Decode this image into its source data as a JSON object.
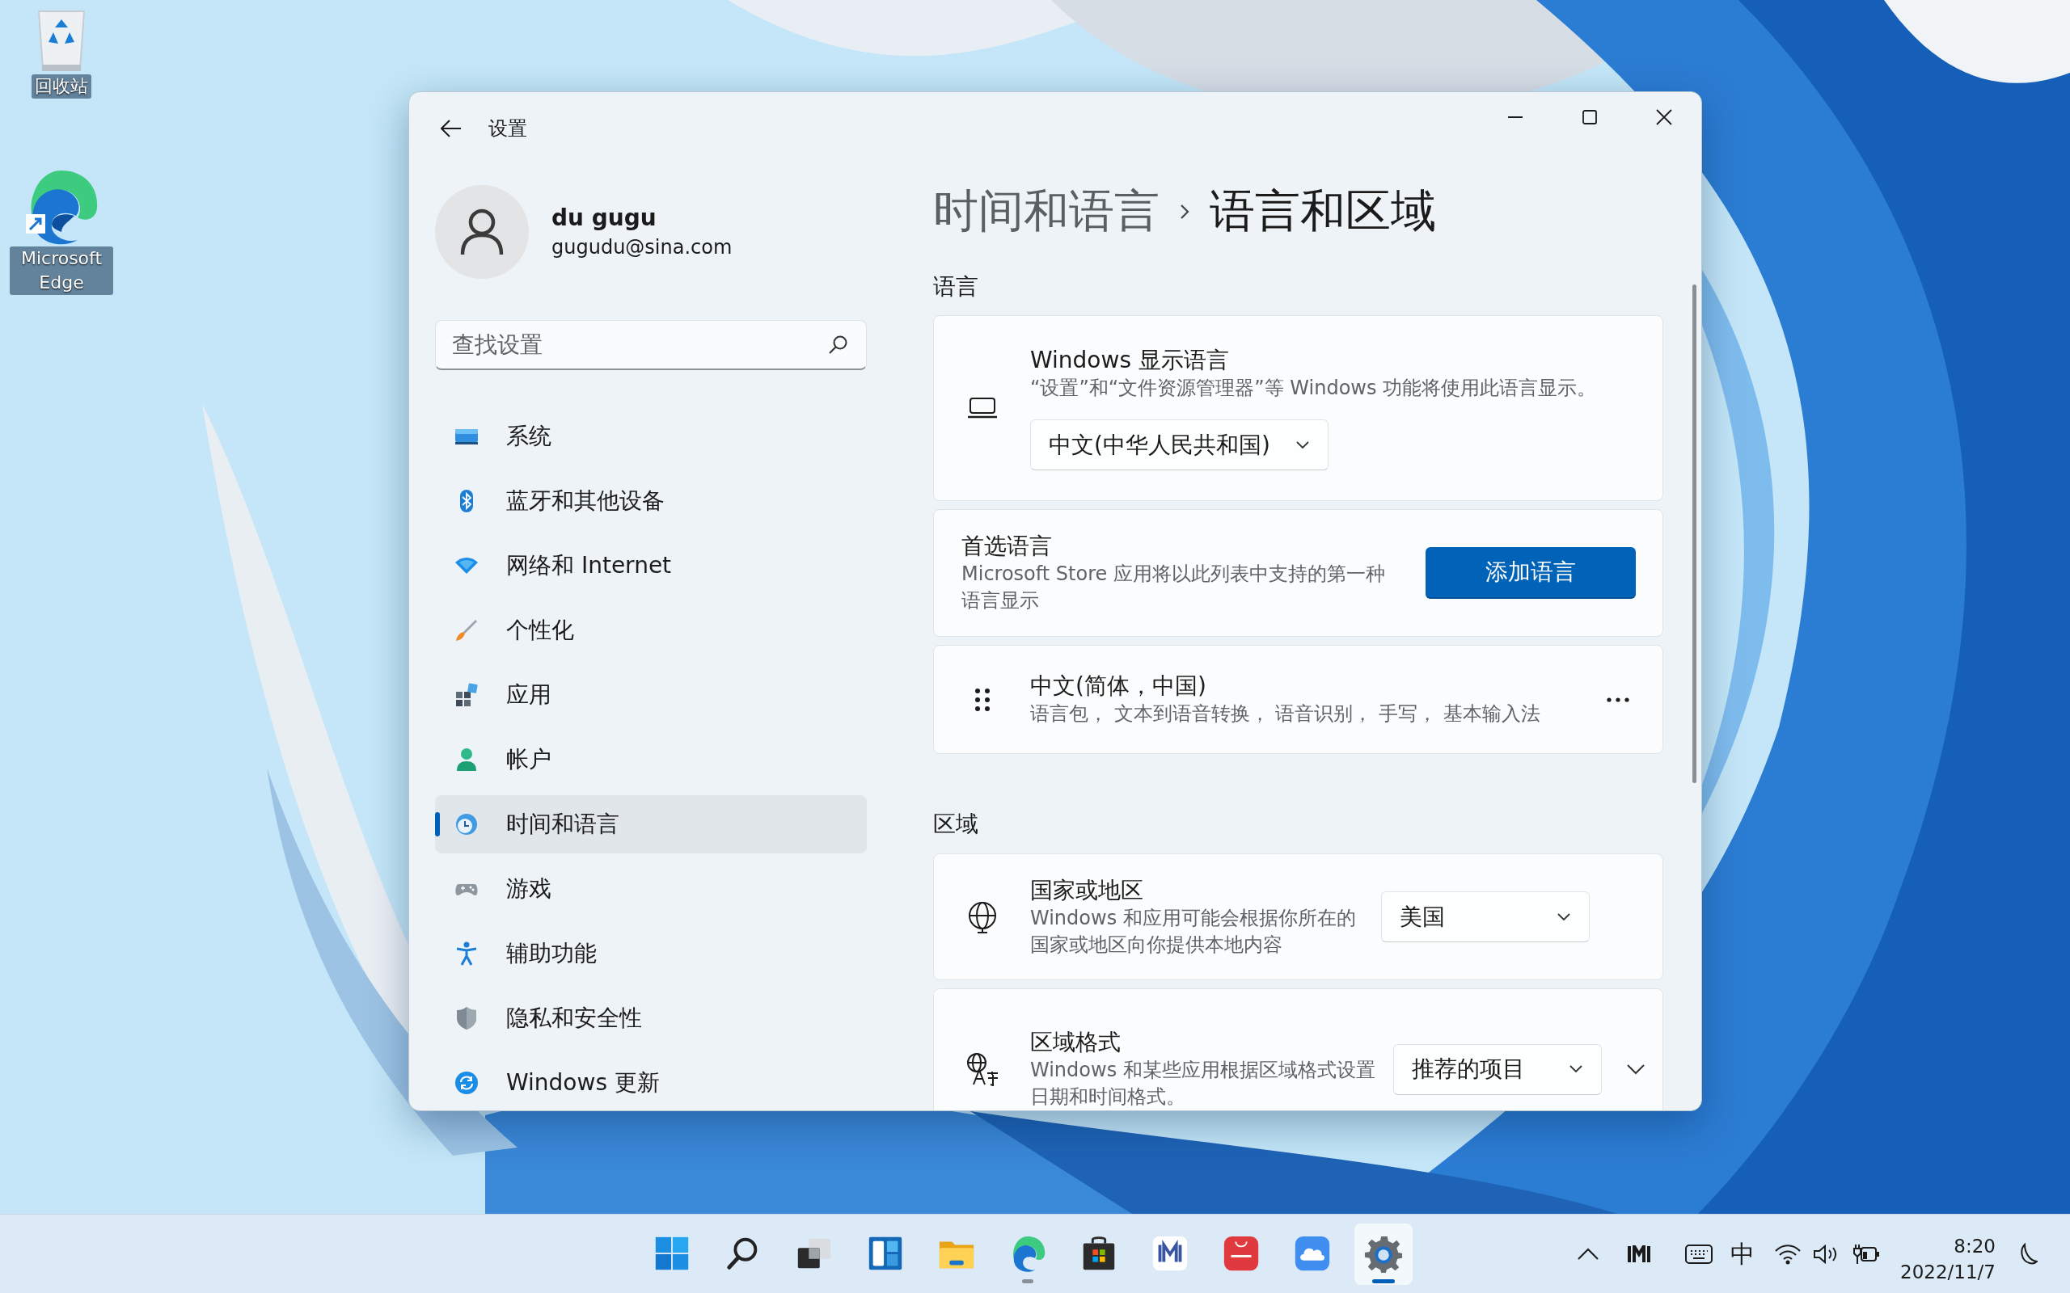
{
  "desktop": {
    "icons": [
      {
        "kind": "recycle-bin",
        "label": "回收站"
      },
      {
        "kind": "edge",
        "label": "Microsoft Edge"
      }
    ]
  },
  "window": {
    "title": "设置"
  },
  "account": {
    "name": "du gugu",
    "email": "gugudu@sina.com"
  },
  "search": {
    "placeholder": "查找设置"
  },
  "nav": [
    {
      "kind": "system",
      "label": "系统",
      "selected": false
    },
    {
      "kind": "bluetooth",
      "label": "蓝牙和其他设备",
      "selected": false
    },
    {
      "kind": "network",
      "label": "网络和 Internet",
      "selected": false
    },
    {
      "kind": "personalize",
      "label": "个性化",
      "selected": false
    },
    {
      "kind": "apps",
      "label": "应用",
      "selected": false
    },
    {
      "kind": "accounts",
      "label": "帐户",
      "selected": false
    },
    {
      "kind": "time",
      "label": "时间和语言",
      "selected": true
    },
    {
      "kind": "gaming",
      "label": "游戏",
      "selected": false
    },
    {
      "kind": "accessibility",
      "label": "辅助功能",
      "selected": false
    },
    {
      "kind": "privacy",
      "label": "隐私和安全性",
      "selected": false
    },
    {
      "kind": "update",
      "label": "Windows 更新",
      "selected": false
    }
  ],
  "breadcrumb": {
    "parent": "时间和语言",
    "current": "语言和区域"
  },
  "sections": [
    {
      "heading": "语言",
      "cards": [
        {
          "kind": "stacked",
          "title": "Windows 显示语言",
          "description": "“设置”和“文件资源管理器”等 Windows 功能将使用此语言显示。",
          "dropdown": "中文(中华人民共和国)"
        },
        {
          "kind": "row",
          "title": "首选语言",
          "description": "Microsoft Store 应用将以此列表中支持的第一种语言显示",
          "button": "添加语言"
        },
        {
          "kind": "row",
          "title": "中文(简体，中国)",
          "description": "语言包， 文本到语音转换， 语音识别， 手写， 基本输入法",
          "menu": true
        }
      ]
    },
    {
      "heading": "区域",
      "cards": [
        {
          "kind": "row",
          "title": "国家或地区",
          "description": "Windows 和应用可能会根据你所在的国家或地区向你提供本地内容",
          "dropdown": "美国"
        },
        {
          "kind": "row",
          "title": "区域格式",
          "description": "Windows 和某些应用根据区域格式设置日期和时间格式。",
          "dropdown": "推荐的项目",
          "expanded": false
        }
      ]
    }
  ],
  "taskbar": {
    "apps": [
      {
        "kind": "start",
        "running": false,
        "active": false
      },
      {
        "kind": "search",
        "running": false,
        "active": false
      },
      {
        "kind": "task-view",
        "running": false,
        "active": false
      },
      {
        "kind": "widgets",
        "running": false,
        "active": false
      },
      {
        "kind": "explorer",
        "running": false,
        "active": false
      },
      {
        "kind": "edge",
        "running": true,
        "active": false
      },
      {
        "kind": "store",
        "running": false,
        "active": false
      },
      {
        "kind": "imi",
        "running": false,
        "active": false
      },
      {
        "kind": "huawei",
        "running": false,
        "active": false
      },
      {
        "kind": "cloud",
        "running": false,
        "active": false
      },
      {
        "kind": "settings",
        "running": true,
        "active": true
      }
    ],
    "tray": {
      "ime": "中",
      "time": "8:20",
      "date": "2022/11/7"
    }
  }
}
